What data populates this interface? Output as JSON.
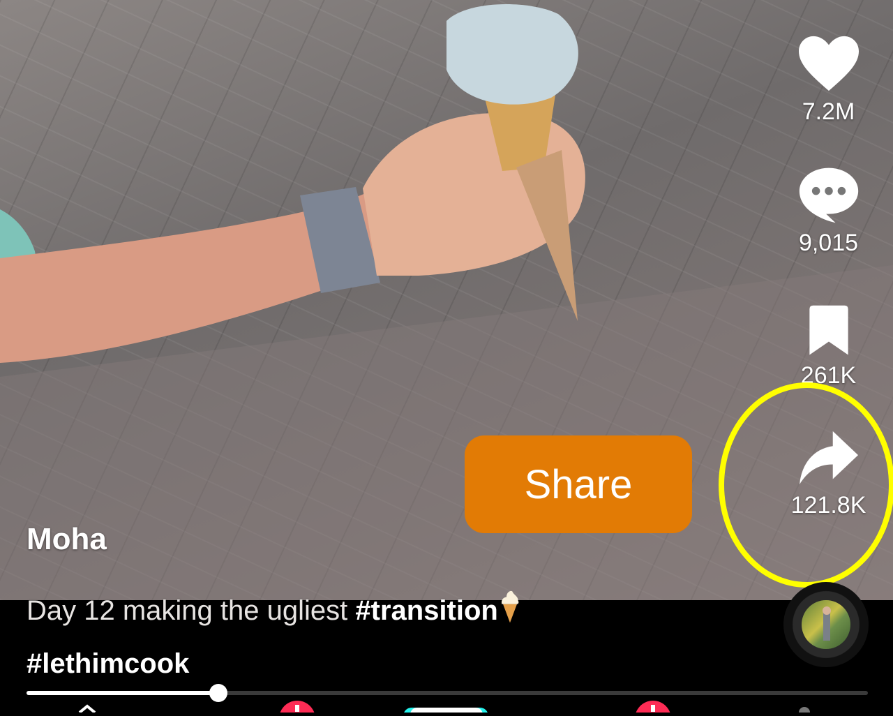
{
  "feed": {
    "username": "Moha",
    "caption": {
      "lead": "Day 12 making the ugliest ",
      "tag1": "#transition",
      "emoji": "soft-ice-cream-emoji",
      "tag2": "#lethimcook"
    },
    "playback_progress": 0.228
  },
  "actions": {
    "like_count": "7.2M",
    "comment_count": "9,015",
    "save_count": "261K",
    "share_count": "121.8K"
  },
  "overlay": {
    "share_tooltip": "Share",
    "highlight_color": "#ffff00",
    "tooltip_color": "#e27b05"
  },
  "icons": [
    "heart-icon",
    "comment-bubble-icon",
    "bookmark-icon",
    "share-arrow-icon",
    "music-disc-icon",
    "home-icon",
    "notification-badge-icon",
    "create-button-icon",
    "inbox-icon",
    "profile-icon"
  ]
}
